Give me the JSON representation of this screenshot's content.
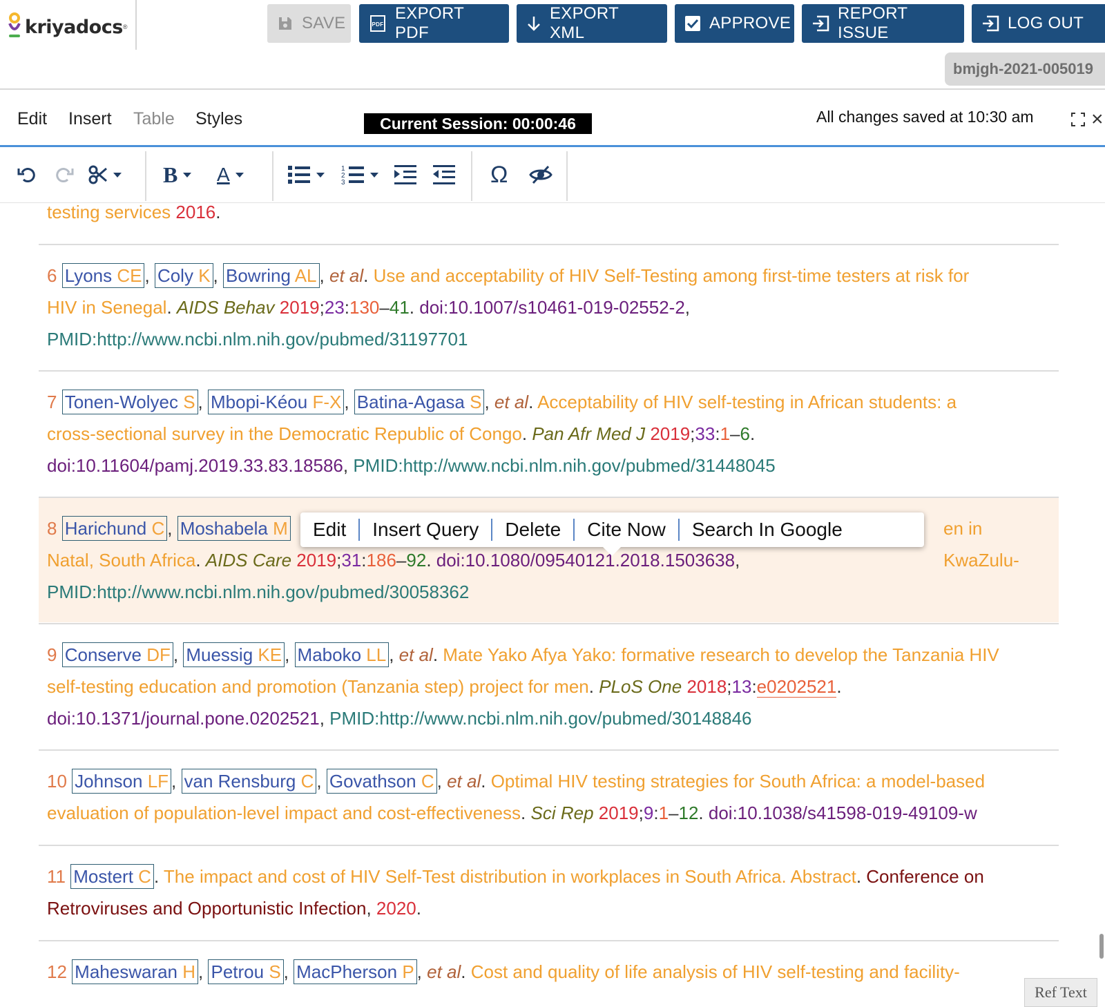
{
  "app": {
    "name": "kriyadocs",
    "doc_id": "bmjgh-2021-005019"
  },
  "toolbar_buttons": {
    "save": "SAVE",
    "export_pdf": "EXPORT PDF",
    "export_xml": "EXPORT XML",
    "approve": "APPROVE",
    "report_issue": "REPORT ISSUE",
    "log_out": "LOG OUT"
  },
  "menu": {
    "edit": "Edit",
    "insert": "Insert",
    "table": "Table",
    "styles": "Styles"
  },
  "session": "Current Session: 00:00:46",
  "save_status": "All changes saved at 10:30 am",
  "context_menu": [
    "Edit",
    "Insert Query",
    "Delete",
    "Cite Now",
    "Search In Google"
  ],
  "ref_text_tab": "Ref Text",
  "colors": {
    "primary": "#1d4e7e",
    "active_ref_bg": "#fdf1e6",
    "accent": "#4a90d9"
  },
  "ref5_tail": {
    "title_end": "testing services",
    "year": "2016"
  },
  "refs": [
    {
      "num": "6",
      "authors": [
        {
          "sur": "Lyons",
          "ini": "CE"
        },
        {
          "sur": "Coly",
          "ini": "K"
        },
        {
          "sur": "Bowring",
          "ini": "AL"
        }
      ],
      "etal": "et al",
      "title_l1": "Use and acceptability of HIV Self-Testing among first-time testers at risk for",
      "title_l2": "HIV in Senegal",
      "journal": "AIDS Behav",
      "year": "2019",
      "vol": "23",
      "fpage": "130",
      "lpage": "41",
      "doi": "doi:10.1007/s10461-019-02552-2",
      "pmid": "PMID:http://www.ncbi.nlm.nih.gov/pubmed/31197701"
    },
    {
      "num": "7",
      "authors": [
        {
          "sur": "Tonen-Wolyec",
          "ini": "S"
        },
        {
          "sur": "Mbopi-Kéou",
          "ini": "F-X"
        },
        {
          "sur": "Batina-Agasa",
          "ini": "S"
        }
      ],
      "etal": "et al",
      "title_l1": "Acceptability of HIV self-testing in African students: a",
      "title_l2": "cross-sectional survey in the Democratic Republic of Congo",
      "journal": "Pan Afr Med J",
      "year": "2019",
      "vol": "33",
      "fpage": "1",
      "lpage": "6",
      "doi": "doi:10.11604/pamj.2019.33.83.18586",
      "pmid": "PMID:http://www.ncbi.nlm.nih.gov/pubmed/31448045"
    },
    {
      "num": "8",
      "authors": [
        {
          "sur": "Harichund",
          "ini": "C"
        },
        {
          "sur": "Moshabela",
          "ini": "M"
        }
      ],
      "title_tail": "en in KwaZulu-",
      "title_l2": "Natal, South Africa",
      "journal": "AIDS Care",
      "year": "2019",
      "vol": "31",
      "fpage": "186",
      "lpage": "92",
      "doi": "doi:10.1080/09540121.2018.1503638",
      "pmid": "PMID:http://www.ncbi.nlm.nih.gov/pubmed/30058362"
    },
    {
      "num": "9",
      "authors": [
        {
          "sur": "Conserve",
          "ini": "DF"
        },
        {
          "sur": "Muessig",
          "ini": "KE"
        },
        {
          "sur": "Maboko",
          "ini": "LL"
        }
      ],
      "etal": "et al",
      "title_l1": "Mate Yako Afya Yako: formative research to develop the Tanzania HIV",
      "title_l2": "self-testing education and promotion (Tanzania step) project for men",
      "journal": "PLoS One",
      "year": "2018",
      "vol": "13",
      "elocation": "e0202521",
      "doi": "doi:10.1371/journal.pone.0202521",
      "pmid": "PMID:http://www.ncbi.nlm.nih.gov/pubmed/30148846"
    },
    {
      "num": "10",
      "authors": [
        {
          "sur": "Johnson",
          "ini": "LF"
        },
        {
          "sur": "van Rensburg",
          "ini": "C"
        },
        {
          "sur": "Govathson",
          "ini": "C"
        }
      ],
      "etal": "et al",
      "title_l1": "Optimal HIV testing strategies for South Africa: a model-based",
      "title_l2": "evaluation of population-level impact and cost-effectiveness",
      "journal": "Sci Rep",
      "year": "2019",
      "vol": "9",
      "fpage": "1",
      "lpage": "12",
      "doi": "doi:10.1038/s41598-019-49109-w"
    },
    {
      "num": "11",
      "authors": [
        {
          "sur": "Mostert",
          "ini": "C"
        }
      ],
      "title_l1": "The impact and cost of HIV Self-Test distribution in workplaces in South Africa. Abstract",
      "conf_l1": "Conference on",
      "conf_l2": "Retroviruses and Opportunistic Infection",
      "year": "2020"
    },
    {
      "num": "12",
      "authors": [
        {
          "sur": "Maheswaran",
          "ini": "H"
        },
        {
          "sur": "Petrou",
          "ini": "S"
        },
        {
          "sur": "MacPherson",
          "ini": "P"
        }
      ],
      "etal": "et al",
      "title_l1": "Cost and quality of life analysis of HIV self-testing and facility-"
    }
  ]
}
